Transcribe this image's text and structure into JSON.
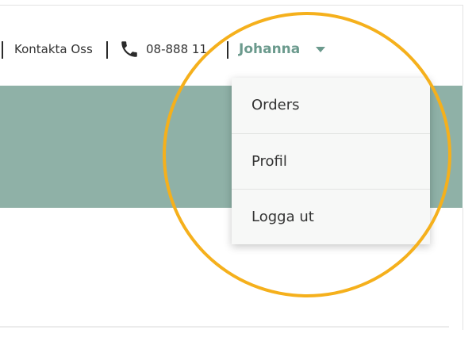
{
  "header": {
    "contact_label": "Kontakta Oss",
    "phone_number": "08-888 11",
    "user_name": "Johanna"
  },
  "user_menu": {
    "items": [
      {
        "label": "Orders"
      },
      {
        "label": "Profil"
      },
      {
        "label": "Logga ut"
      }
    ]
  },
  "annotation": {
    "highlight_color": "#f5b01c"
  },
  "colors": {
    "accent": "#6b9a8d",
    "banner": "#8fb1a7"
  }
}
